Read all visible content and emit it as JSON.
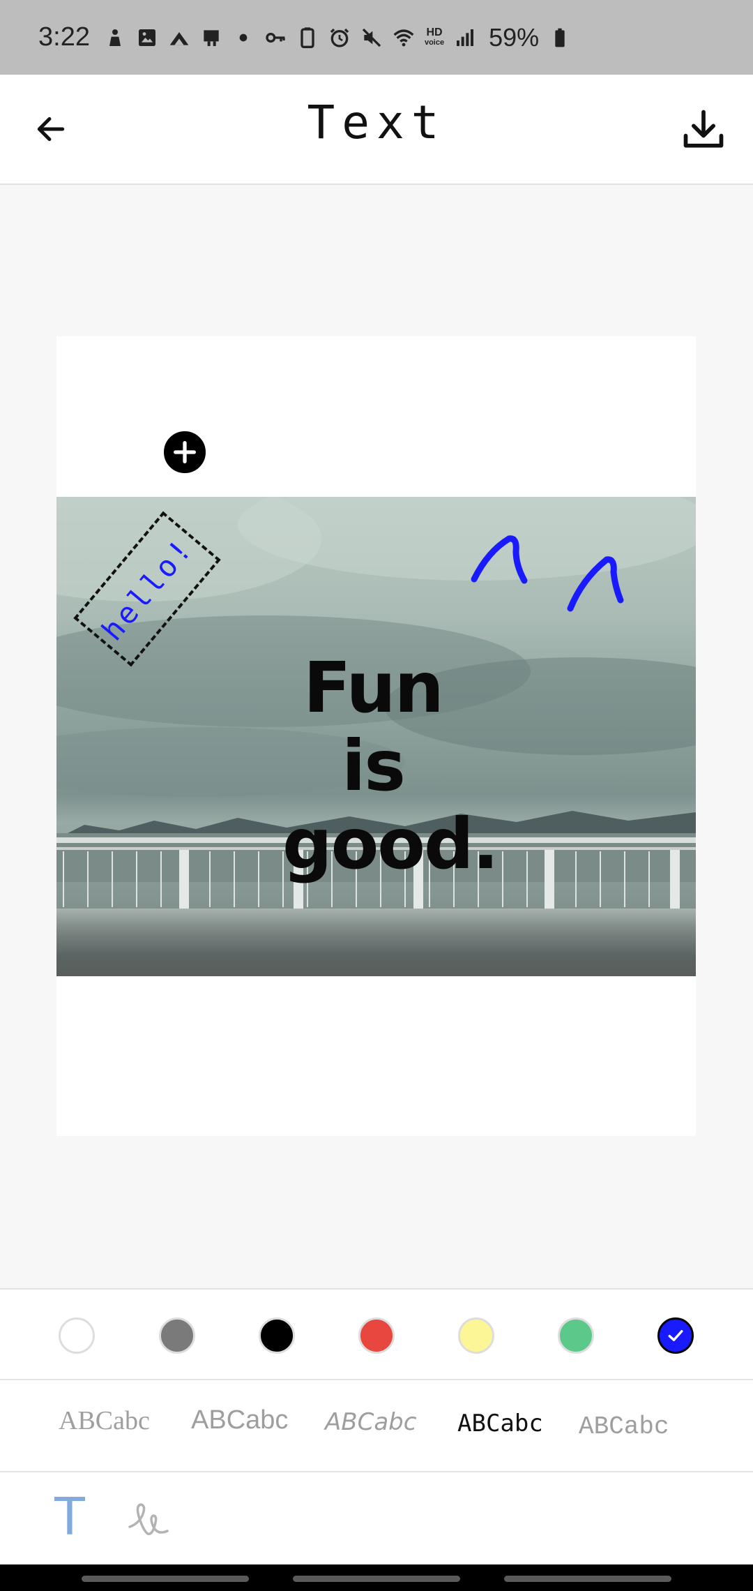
{
  "status_bar": {
    "time": "3:22",
    "hd_label": "HD",
    "hd_sub": "voice",
    "battery": "59%"
  },
  "app_bar": {
    "title": "Text",
    "back_icon": "arrow-left-icon",
    "download_icon": "download-icon"
  },
  "canvas": {
    "main_text_line1": "Fun is",
    "main_text_line2": "good.",
    "selected_text": "hello!",
    "selected_text_color": "#1a1aff"
  },
  "palette": {
    "colors": [
      "#ffffff",
      "#7a7a7a",
      "#000000",
      "#e8473f",
      "#fdf696",
      "#5cc98a",
      "#1a1aff"
    ],
    "selected_color": "#1a1aff"
  },
  "fonts": {
    "samples": [
      "ABCabc",
      "ABCabc",
      "ABCabc",
      "ABCabc",
      "ABCabc"
    ]
  },
  "modes": {
    "text_tab": "T",
    "draw_tab_icon": "handwriting-icon"
  }
}
